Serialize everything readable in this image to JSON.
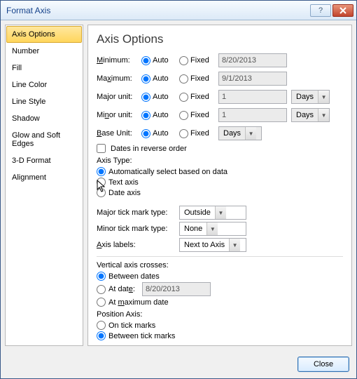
{
  "window": {
    "title": "Format Axis"
  },
  "sidebar": {
    "items": [
      {
        "label": "Axis Options",
        "selected": true
      },
      {
        "label": "Number"
      },
      {
        "label": "Fill"
      },
      {
        "label": "Line Color"
      },
      {
        "label": "Line Style"
      },
      {
        "label": "Shadow"
      },
      {
        "label": "Glow and Soft Edges"
      },
      {
        "label": "3-D Format"
      },
      {
        "label": "Alignment"
      }
    ]
  },
  "panel": {
    "heading": "Axis Options",
    "auto": "Auto",
    "fixed": "Fixed",
    "rows": {
      "minimum": {
        "label": "Minimum:",
        "ul": "M",
        "value": "8/20/2013"
      },
      "maximum": {
        "label": "aximum:",
        "ul": "M",
        "pre": "Ma",
        "value": "9/1/2013"
      },
      "major": {
        "label": "jor unit:",
        "ul": "Ma",
        "value": "1",
        "unit": "Days"
      },
      "minor": {
        "label": "nor unit:",
        "ul": "Mi",
        "value": "1",
        "unit": "Days"
      },
      "base": {
        "label": "ase Unit:",
        "ul": "B",
        "value": "Days"
      }
    },
    "reverse": "Dates in reverse order",
    "axis_type": {
      "label": "Axis Type:",
      "auto": "Automatically select based on data",
      "text": "Text axis",
      "date": "Date axis"
    },
    "tick": {
      "major_label": "Major tick mark type:",
      "major_value": "Outside",
      "minor_label": "Minor tick mark type:",
      "minor_value": "None",
      "axis_labels_label": "Axis labels:",
      "axis_labels_value": "Next to Axis"
    },
    "vcross": {
      "label": "Vertical axis crosses:",
      "between": "Between dates",
      "at_date_label": "At date:",
      "at_date_value": "8/20/2013",
      "at_max": "At maximum date"
    },
    "position": {
      "label": "Position Axis:",
      "on": "On tick marks",
      "between": "Between tick marks"
    }
  },
  "footer": {
    "close": "Close"
  }
}
